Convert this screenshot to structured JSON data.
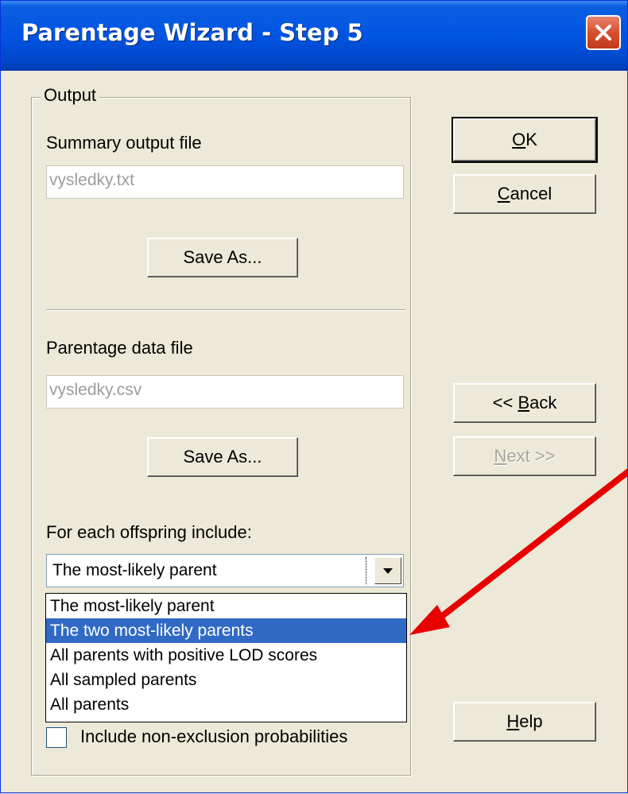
{
  "window": {
    "title": "Parentage Wizard - Step 5"
  },
  "output_group": {
    "title": "Output",
    "summary_label": "Summary output file",
    "summary_value": "vysledky.txt",
    "summary_save_label": "Save As...",
    "parentage_label": "Parentage data file",
    "parentage_value": "vysledky.csv",
    "parentage_save_label": "Save As...",
    "offspring_label": "For each offspring include:",
    "combo_selected": "The most-likely parent",
    "options": [
      "The most-likely parent",
      "The two most-likely parents",
      "All parents with positive LOD scores",
      "All sampled parents",
      "All parents"
    ],
    "highlighted_option_index": 1,
    "checkbox_label": "Include non-exclusion probabilities"
  },
  "buttons": {
    "ok": {
      "mnemonic": "O",
      "rest": "K"
    },
    "cancel": {
      "mnemonic": "C",
      "rest": "ancel"
    },
    "back": {
      "prefix": "<< ",
      "mnemonic": "B",
      "rest": "ack"
    },
    "next": {
      "mnemonic": "N",
      "rest": "ext >>"
    },
    "help": {
      "mnemonic": "H",
      "rest": "elp"
    }
  },
  "colors": {
    "titlebar": "#0054E3",
    "selection": "#316AC5",
    "annotation_arrow": "#E80000"
  },
  "icons": {
    "close": "close-icon",
    "dropdown": "chevron-down-icon"
  }
}
